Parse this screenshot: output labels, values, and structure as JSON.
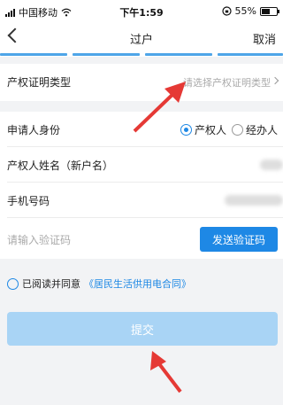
{
  "status_bar": {
    "carrier": "中国移动",
    "time": "下午1:59",
    "battery": "55%",
    "battery_level": 0.55
  },
  "nav": {
    "title": "过户",
    "cancel_label": "取消"
  },
  "progress_segments": 4,
  "form": {
    "cert_type_label": "产权证明类型",
    "cert_type_placeholder": "请选择产权证明类型",
    "identity_label": "申请人身份",
    "identity_options": [
      "产权人",
      "经办人"
    ],
    "identity_selected": "产权人",
    "owner_name_label": "产权人姓名（新户名）",
    "phone_label": "手机号码",
    "code_placeholder": "请输入验证码",
    "send_code_label": "发送验证码"
  },
  "agreement": {
    "prefix": "已阅读并同意",
    "link": "《居民生活供用电合同》"
  },
  "submit_label": "提交",
  "colors": {
    "accent": "#1e88e5",
    "submit_disabled": "#a9d4f5",
    "annotation_arrow": "#e53935"
  }
}
